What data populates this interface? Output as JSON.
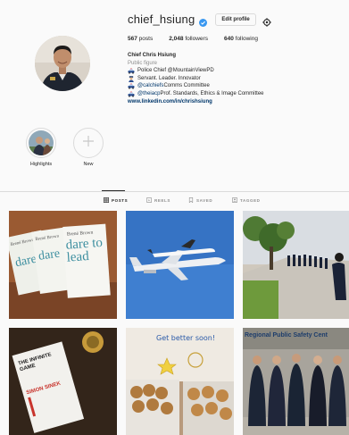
{
  "profile": {
    "username": "chief_hsiung",
    "edit_label": "Edit profile",
    "stats": {
      "posts_count": "567",
      "posts_label": "posts",
      "followers_count": "2,048",
      "followers_label": "followers",
      "following_count": "640",
      "following_label": "following"
    },
    "bio": {
      "name": "Chief Chris Hsiung",
      "category": "Public figure",
      "line1": "Police Chief @MountainViewPD",
      "line2": "Servant. Leader. Innovator",
      "line3_handle": "@calchiefs",
      "line3_rest": " Comms Committee",
      "line4_handle": "@theiacp",
      "line4_rest": " Prof. Standards, Ethics & Image Committee",
      "website": "www.linkedin.com/in/chrishsiung"
    }
  },
  "highlights": [
    {
      "label": "Highlights"
    },
    {
      "label": "New"
    }
  ],
  "tabs": [
    {
      "label": "POSTS",
      "icon": "grid-icon",
      "active": true
    },
    {
      "label": "REELS",
      "icon": "reels-icon",
      "active": false
    },
    {
      "label": "SAVED",
      "icon": "bookmark-icon",
      "active": false
    },
    {
      "label": "TAGGED",
      "icon": "tagged-icon",
      "active": false
    }
  ],
  "posts": {
    "book_left_author": "Brené Brown",
    "book_left_text": "dare",
    "book_center_author": "Brené Brown",
    "book_center_text": "dare to lead",
    "book_white_title": "THE INFINITE GAME",
    "book_white_author": "SIMON SINEK",
    "card_text": "Get better soon!",
    "sign_text": "Regional Public Safety Cent"
  },
  "colors": {
    "accent_link": "#00376b",
    "verified_blue": "#3897f0",
    "border": "#dbdbdb",
    "muted": "#8e8e8e"
  }
}
